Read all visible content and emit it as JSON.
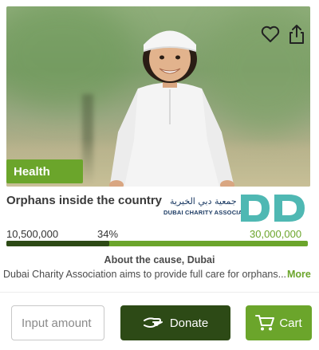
{
  "card": {
    "category_tag": "Health",
    "title": "Orphans inside the country",
    "partner_logo": {
      "name_ar": "جمعية دبي الخيرية",
      "name_en": "DUBAI CHARITY ASSOCIATION"
    },
    "icons": {
      "favorite": "heart-icon",
      "share": "share-icon"
    }
  },
  "progress": {
    "raised": "10,500,000",
    "percent_label": "34%",
    "percent": 34,
    "goal": "30,000,000"
  },
  "about": {
    "heading": "About the cause, Dubai",
    "description": "Dubai Charity Association aims to provide full care for orphans...",
    "more_label": "More"
  },
  "actions": {
    "amount_placeholder": "Input amount",
    "donate_label": "Donate",
    "cart_label": "Cart",
    "donate_icon": "donate-hand-icon",
    "cart_icon": "cart-icon"
  },
  "colors": {
    "brand_green": "#6ba52b",
    "dark_green": "#2d4a16"
  }
}
